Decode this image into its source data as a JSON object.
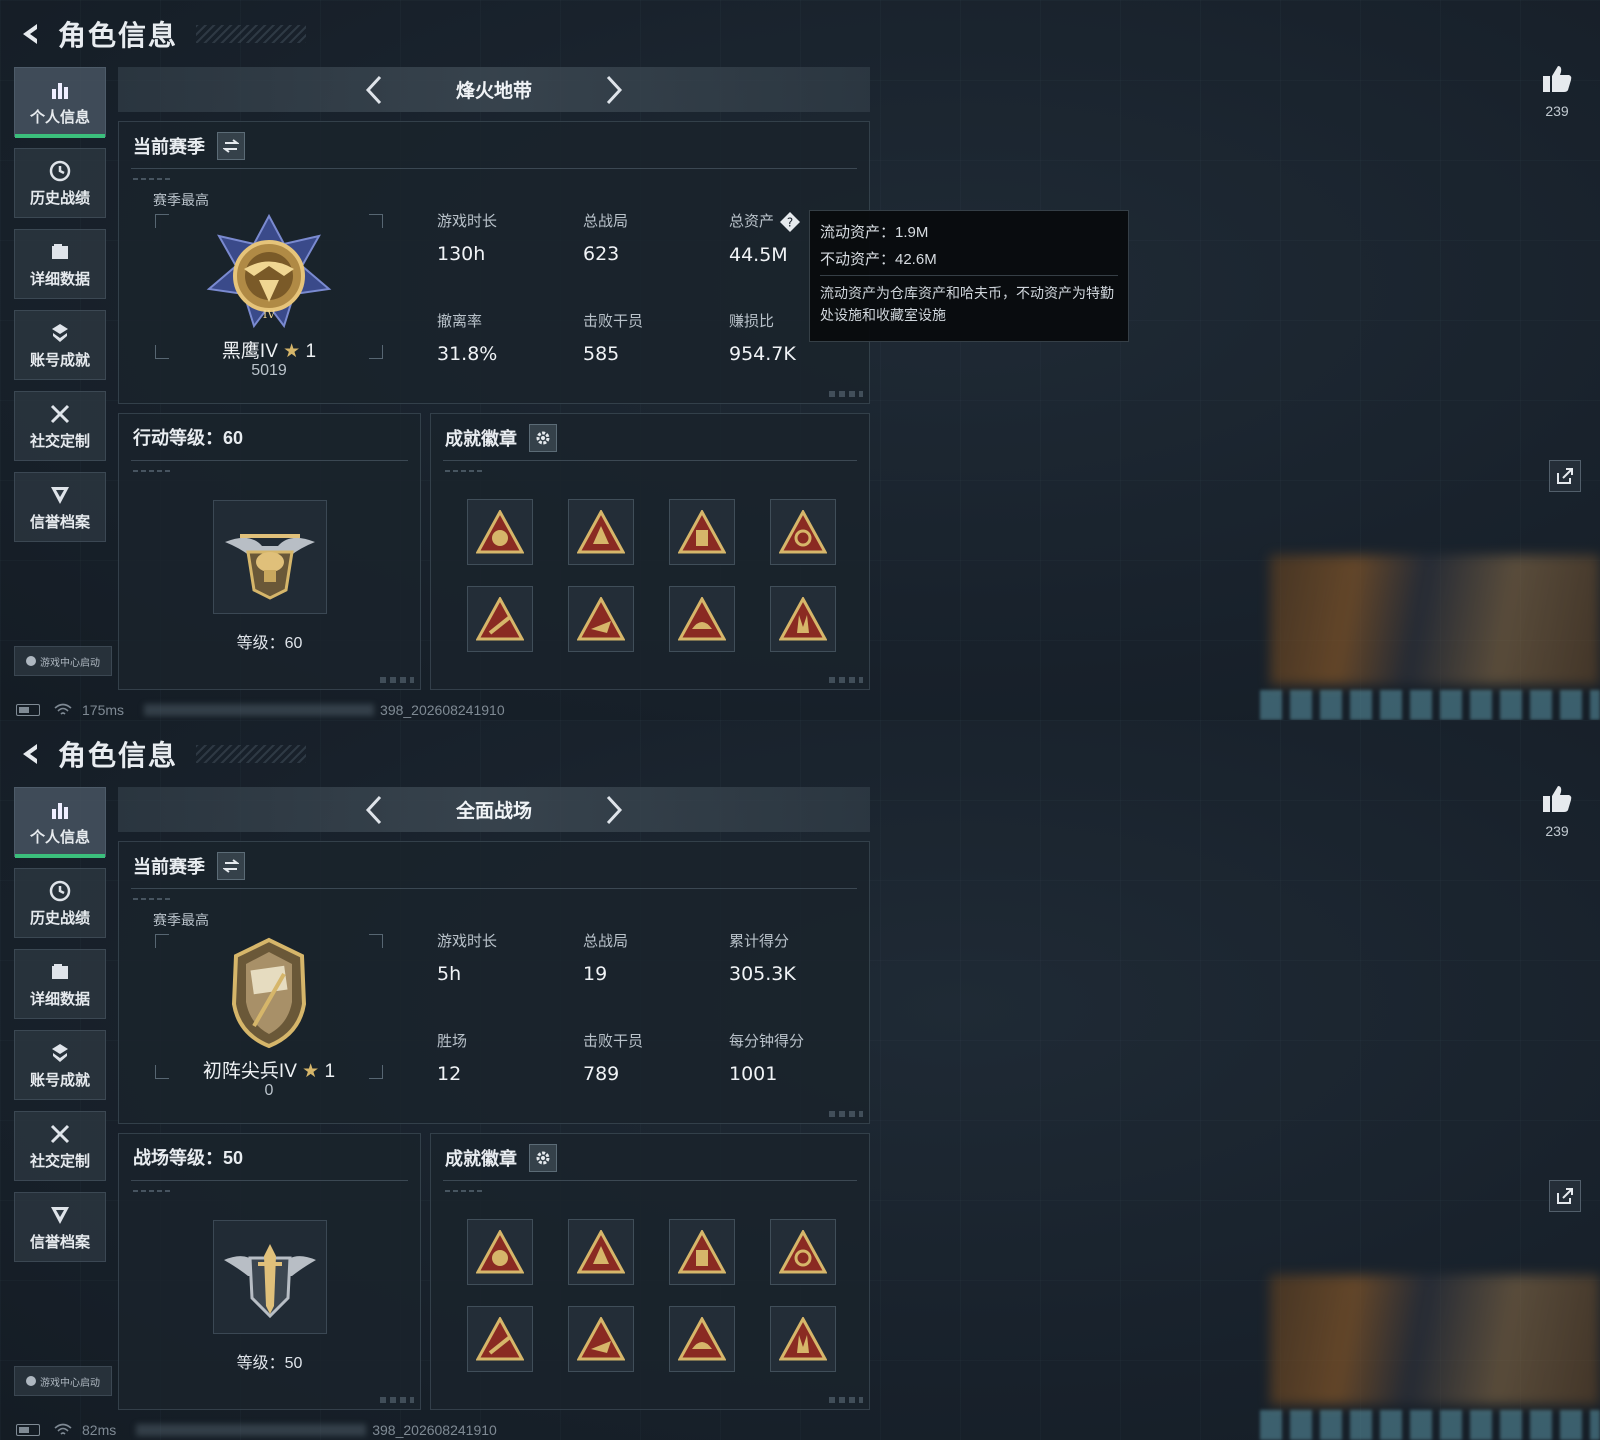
{
  "screens": [
    {
      "header": {
        "title": "角色信息"
      },
      "sidebar": {
        "items": [
          {
            "label": "个人信息",
            "icon": "bar-chart-icon",
            "active": true
          },
          {
            "label": "历史战绩",
            "icon": "history-icon"
          },
          {
            "label": "详细数据",
            "icon": "folder-icon"
          },
          {
            "label": "账号成就",
            "icon": "achievement-icon"
          },
          {
            "label": "社交定制",
            "icon": "tools-icon"
          },
          {
            "label": "信誉档案",
            "icon": "reputation-icon"
          }
        ],
        "game_center": "游戏中心启动"
      },
      "mode": {
        "name": "烽火地带"
      },
      "season": {
        "title": "当前赛季",
        "best_label": "赛季最高",
        "rank_name": "黑鹰IV",
        "rank_star": "★",
        "rank_star_count": "1",
        "rank_score": "5019",
        "stats": [
          {
            "label": "游戏时长",
            "value": "130h"
          },
          {
            "label": "总战局",
            "value": "623"
          },
          {
            "label": "总资产",
            "value": "44.5M"
          },
          {
            "label": "撤离率",
            "value": "31.8%"
          },
          {
            "label": "击败干员",
            "value": "585"
          },
          {
            "label": "赚损比",
            "value": "954.7K"
          }
        ]
      },
      "tooltip": {
        "line1": "流动资产：1.9M",
        "line2": "不动资产：42.6M",
        "desc": "流动资产为仓库资产和哈夫币，不动资产为特勤处设施和收藏室设施"
      },
      "level": {
        "title": "行动等级：60",
        "text": "等级：60"
      },
      "badges": {
        "title": "成就徽章"
      },
      "likes": {
        "count": "239"
      },
      "footer": {
        "ping": "175ms",
        "build": "398_202608241910"
      }
    },
    {
      "header": {
        "title": "角色信息"
      },
      "sidebar": {
        "items": [
          {
            "label": "个人信息",
            "icon": "bar-chart-icon",
            "active": true
          },
          {
            "label": "历史战绩",
            "icon": "history-icon"
          },
          {
            "label": "详细数据",
            "icon": "folder-icon"
          },
          {
            "label": "账号成就",
            "icon": "achievement-icon"
          },
          {
            "label": "社交定制",
            "icon": "tools-icon"
          },
          {
            "label": "信誉档案",
            "icon": "reputation-icon"
          }
        ],
        "game_center": "游戏中心启动"
      },
      "mode": {
        "name": "全面战场"
      },
      "season": {
        "title": "当前赛季",
        "best_label": "赛季最高",
        "rank_name": "初阵尖兵IV",
        "rank_star": "★",
        "rank_star_count": "1",
        "rank_score": "0",
        "stats": [
          {
            "label": "游戏时长",
            "value": "5h"
          },
          {
            "label": "总战局",
            "value": "19"
          },
          {
            "label": "累计得分",
            "value": "305.3K"
          },
          {
            "label": "胜场",
            "value": "12"
          },
          {
            "label": "击败干员",
            "value": "789"
          },
          {
            "label": "每分钟得分",
            "value": "1001"
          }
        ]
      },
      "level": {
        "title": "战场等级：50",
        "text": "等级：50"
      },
      "badges": {
        "title": "成就徽章"
      },
      "likes": {
        "count": "239"
      },
      "footer": {
        "ping": "82ms",
        "build": "398_202608241910"
      }
    }
  ],
  "colors": {
    "accent": "#3bbf7c",
    "gold": "#d6b66a",
    "badge_red": "#8a2a22"
  }
}
